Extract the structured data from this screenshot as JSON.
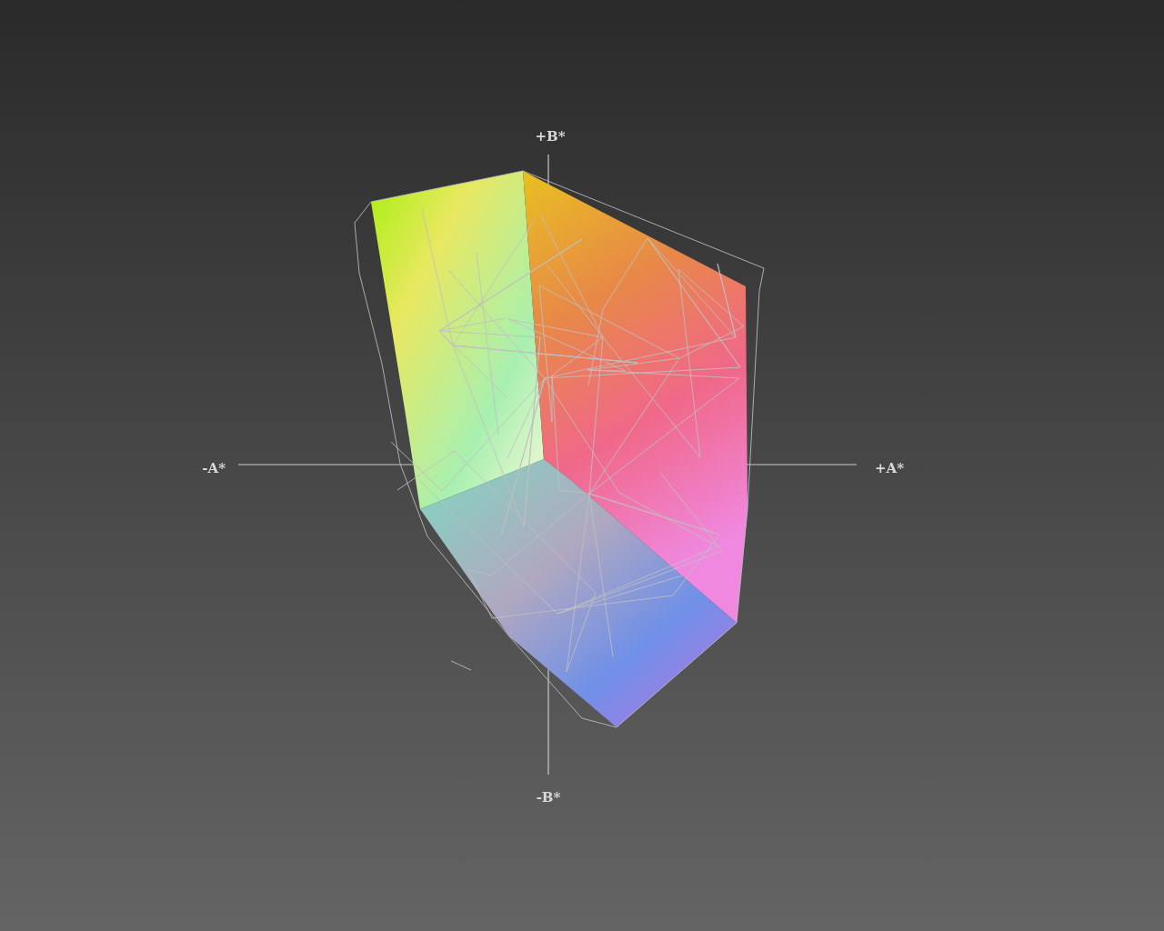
{
  "axes": [
    {
      "kind": "up",
      "label": "+B*"
    },
    {
      "kind": "left",
      "label": "-A*"
    },
    {
      "kind": "right",
      "label": "+A*"
    },
    {
      "kind": "down",
      "label": "-B*"
    }
  ]
}
